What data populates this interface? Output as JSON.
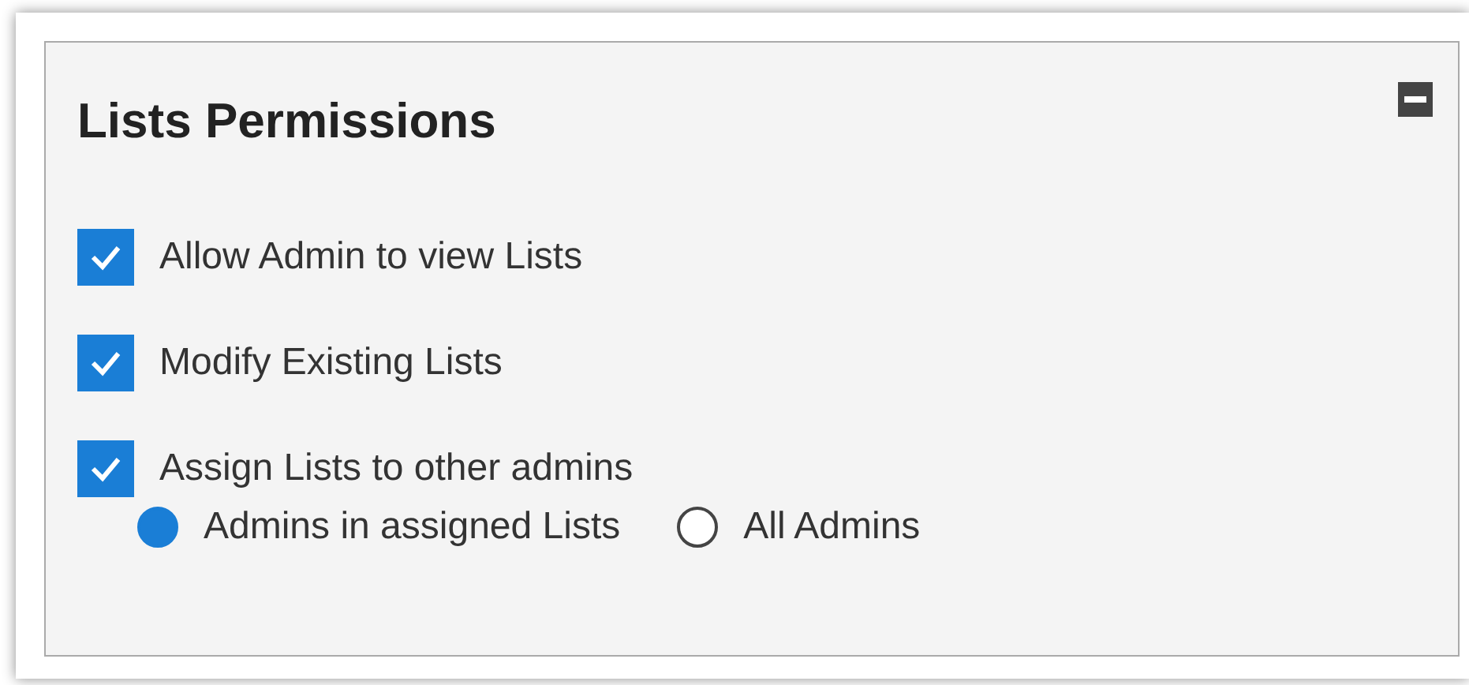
{
  "panel": {
    "title": "Lists Permissions"
  },
  "options": [
    {
      "label": "Allow Admin to view Lists",
      "checked": true
    },
    {
      "label": "Modify Existing Lists",
      "checked": true
    },
    {
      "label": "Assign Lists to other admins",
      "checked": true
    }
  ],
  "scope": [
    {
      "label": "Admins in assigned Lists",
      "selected": true
    },
    {
      "label": "All Admins",
      "selected": false
    }
  ]
}
